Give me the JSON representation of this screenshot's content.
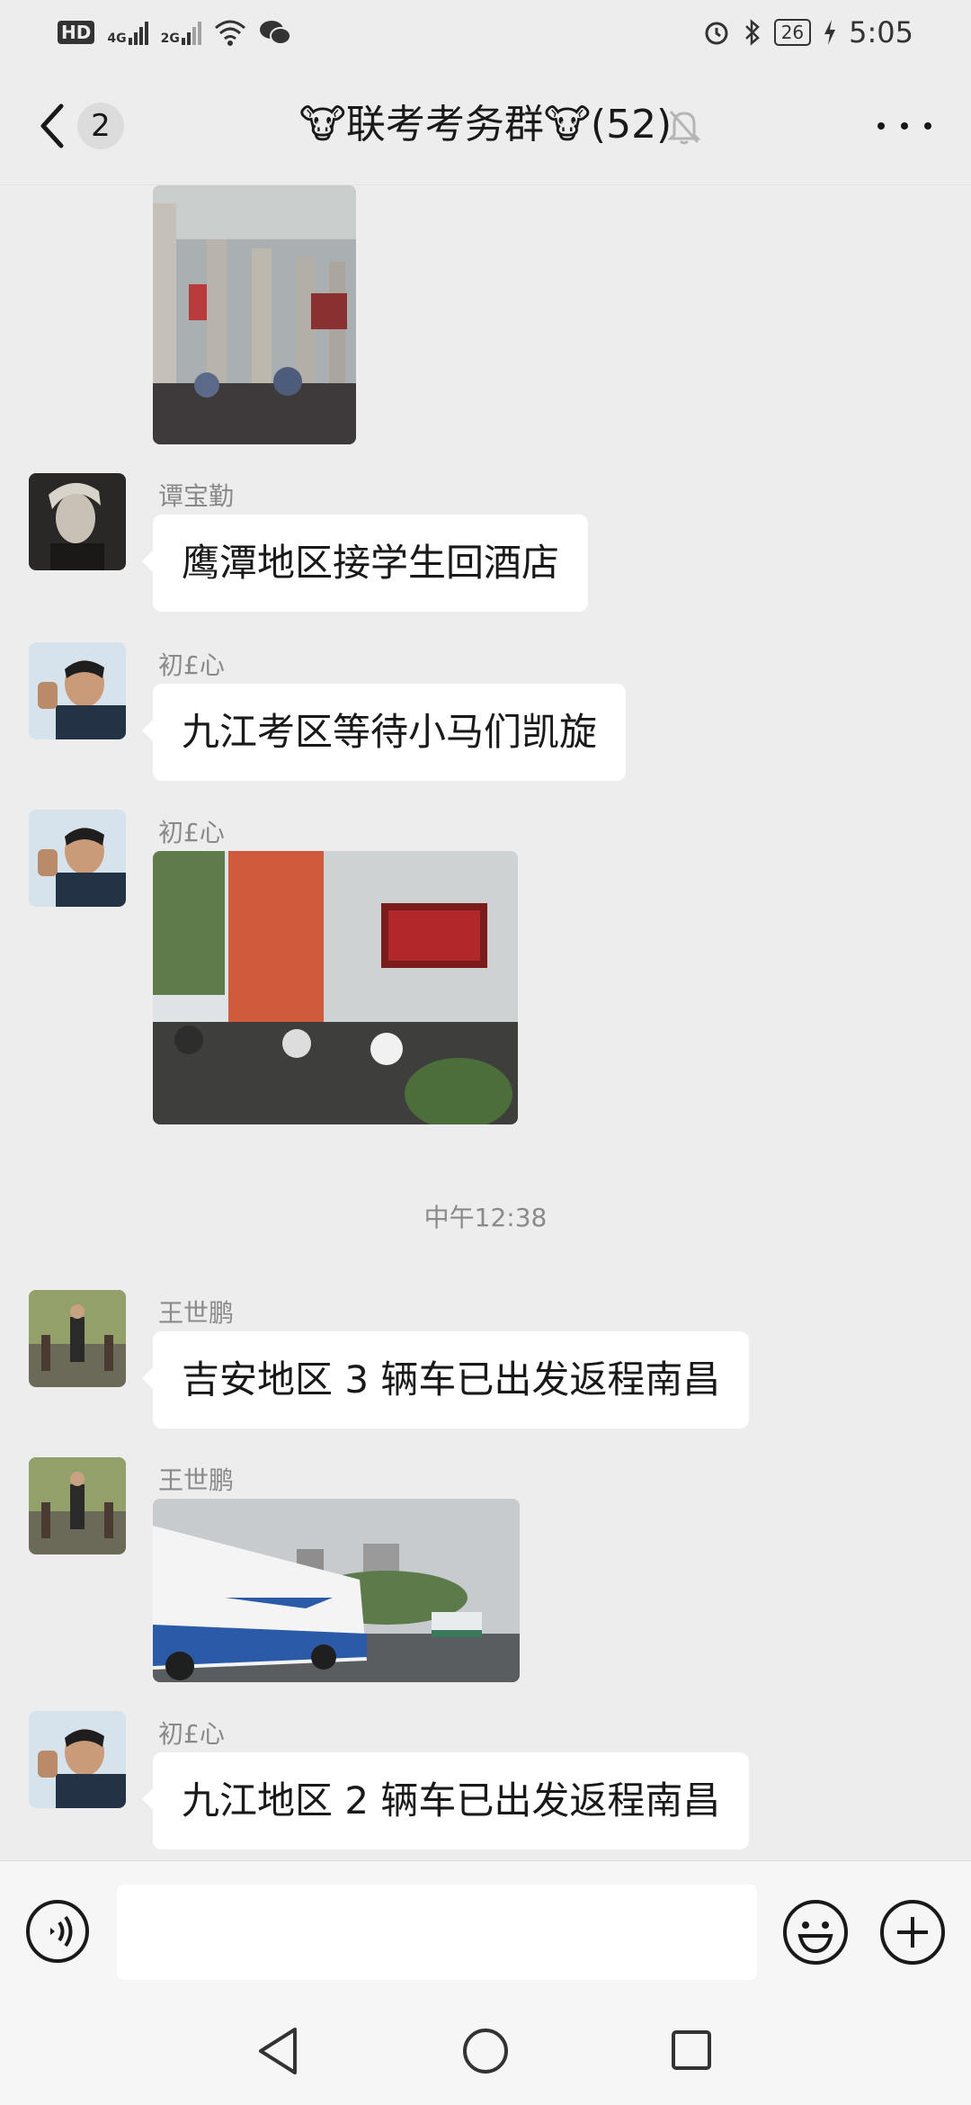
{
  "status_bar": {
    "hd": "HD",
    "sim1_net": "4G",
    "sim2_net": "2G",
    "battery": "26",
    "time": "5:05",
    "icons": [
      "signal-icon",
      "wifi-icon",
      "wechat-icon",
      "alarm-icon",
      "bluetooth-icon",
      "battery-icon",
      "charging-icon"
    ]
  },
  "header": {
    "unread_count": "2",
    "title": "🐮联考考务群🐮(52)",
    "icons": [
      "back-icon",
      "mute-bell-icon",
      "more-icon"
    ]
  },
  "messages": [
    {
      "sender": "谭宝勤",
      "text": "鹰潭地区接学生回酒店"
    },
    {
      "sender": "初£心",
      "text": "九江考区等待小马们凯旋"
    },
    {
      "sender": "初£心"
    },
    {
      "sender": "王世鹏",
      "text": "吉安地区 3 辆车已出发返程南昌"
    },
    {
      "sender": "王世鹏"
    },
    {
      "sender": "初£心",
      "text": "九江地区 2 辆车已出发返程南昌"
    }
  ],
  "time_separator": "中午12:38",
  "input_bar": {
    "icons": [
      "voice-icon",
      "emoji-icon",
      "plus-icon"
    ]
  },
  "colors": {
    "background": "#ededed",
    "bubble": "#ffffff",
    "secondary_text": "#8a8a8a"
  }
}
